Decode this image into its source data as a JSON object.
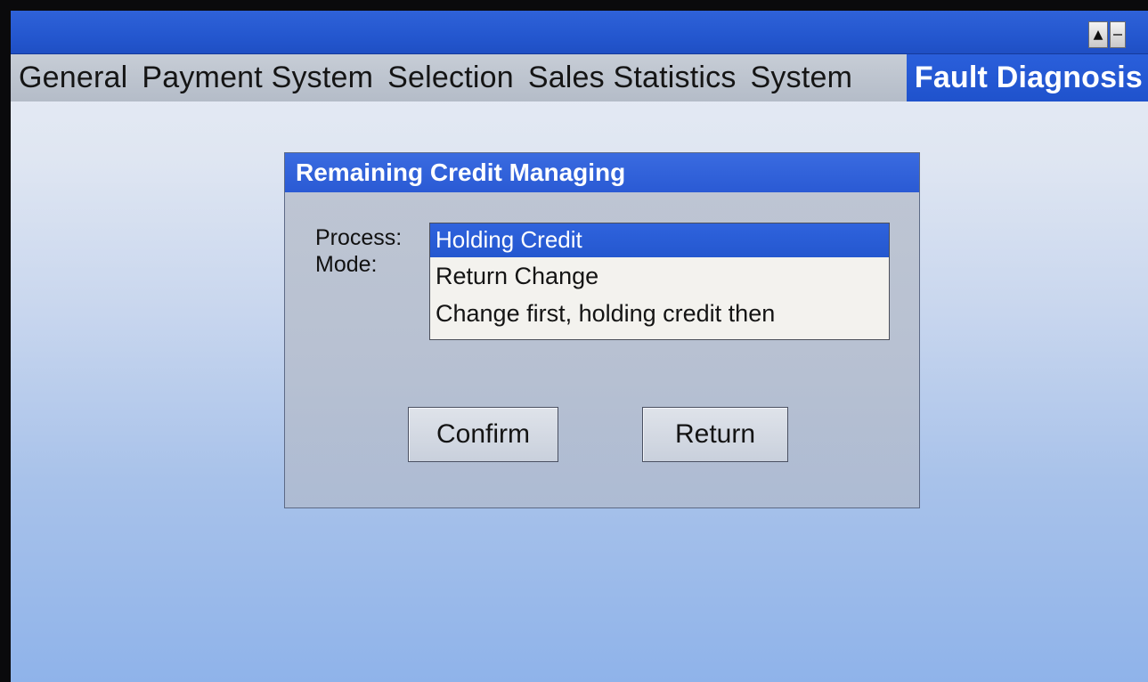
{
  "window": {
    "buttons": {
      "up_glyph": "▲"
    }
  },
  "tabs": [
    {
      "label": "General",
      "active": false
    },
    {
      "label": "Payment System",
      "active": false
    },
    {
      "label": "Selection",
      "active": false
    },
    {
      "label": "Sales Statistics",
      "active": false
    },
    {
      "label": "System",
      "active": false
    },
    {
      "label": "Fault Diagnosis",
      "active": true
    }
  ],
  "dialog": {
    "title": "Remaining Credit Managing",
    "field_label_line1": "Process:",
    "field_label_line2": "Mode:",
    "options": [
      {
        "label": "Holding Credit",
        "selected": true
      },
      {
        "label": "Return Change",
        "selected": false
      },
      {
        "label": "Change first, holding credit then",
        "selected": false
      }
    ],
    "confirm_label": "Confirm",
    "return_label": "Return"
  },
  "colors": {
    "accent_blue": "#2a5ad4",
    "tab_bar_gray": "#bcc3ce",
    "background_top": "#e9edf5",
    "background_bottom": "#8fb3ea"
  }
}
